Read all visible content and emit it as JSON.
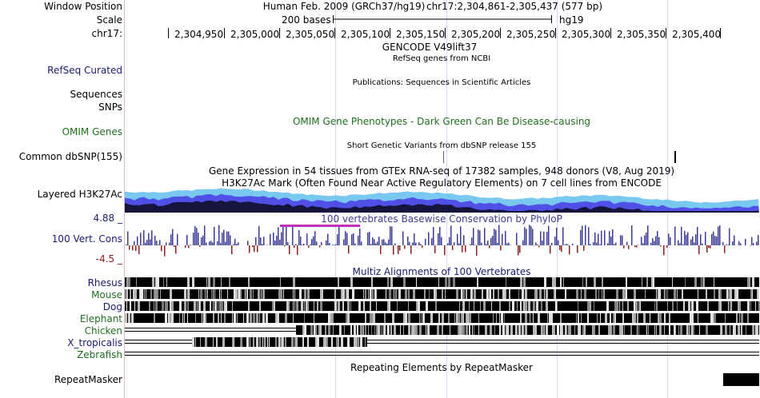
{
  "header": {
    "window_position_label": "Window Position",
    "scale_label": "Scale",
    "chrom_label": "chr17:",
    "assembly": "Human Feb. 2009 (GRCh37/hg19)",
    "position": "chr17:2,304,861-2,305,437 (577 bp)",
    "scale_text": "200 bases",
    "scale_db": "hg19",
    "ticks": [
      "2,304,950",
      "2,305,000",
      "2,305,050",
      "2,305,100",
      "2,305,150",
      "2,305,200",
      "2,305,250",
      "2,305,300",
      "2,305,350",
      "2,305,400"
    ]
  },
  "tracks": {
    "gencode": {
      "title": "GENCODE V49lift37"
    },
    "refseq": {
      "label": "RefSeq Curated",
      "title": "RefSeq genes from NCBI"
    },
    "publications": {
      "label": "Sequences",
      "title": "Publications: Sequences in Scientific Articles"
    },
    "snps": {
      "label": "SNPs"
    },
    "omim": {
      "label": "OMIM Genes",
      "title": "OMIM Gene Phenotypes - Dark Green Can Be Disease-causing"
    },
    "dbsnp": {
      "label": "Common dbSNP(155)",
      "title": "Short Genetic Variants from dbSNP release 155"
    },
    "gtex": {
      "title": "Gene Expression in 54 tissues from GTEx RNA-seq of 17382 samples, 948 donors (V8, Aug 2019)"
    },
    "h3k27ac": {
      "label": "Layered H3K27Ac",
      "title": "H3K27Ac Mark (Often Found Near Active Regulatory Elements) on 7 cell lines from ENCODE"
    },
    "conservation": {
      "label": "100 Vert. Cons",
      "title": "100 vertebrates Basewise Conservation by PhyloP",
      "max": "4.88 _",
      "min": "-4.5 _"
    },
    "multiz": {
      "title": "Multiz Alignments of 100 Vertebrates",
      "species": [
        "Rhesus",
        "Mouse",
        "Dog",
        "Elephant",
        "Chicken",
        "X_tropicalis",
        "Zebrafish"
      ]
    },
    "repeatmasker": {
      "label": "RepeatMasker",
      "title": "Repeating Elements by RepeatMasker"
    }
  },
  "colors": {
    "navy": "#1a1a6e",
    "green": "#1f6e1f",
    "cons_pos": "#3c3c96",
    "cons_neg": "#8b2020",
    "h3k_light": "#78c8f0",
    "h3k_mid": "#5050e6",
    "h3k_dark": "#14143c"
  }
}
